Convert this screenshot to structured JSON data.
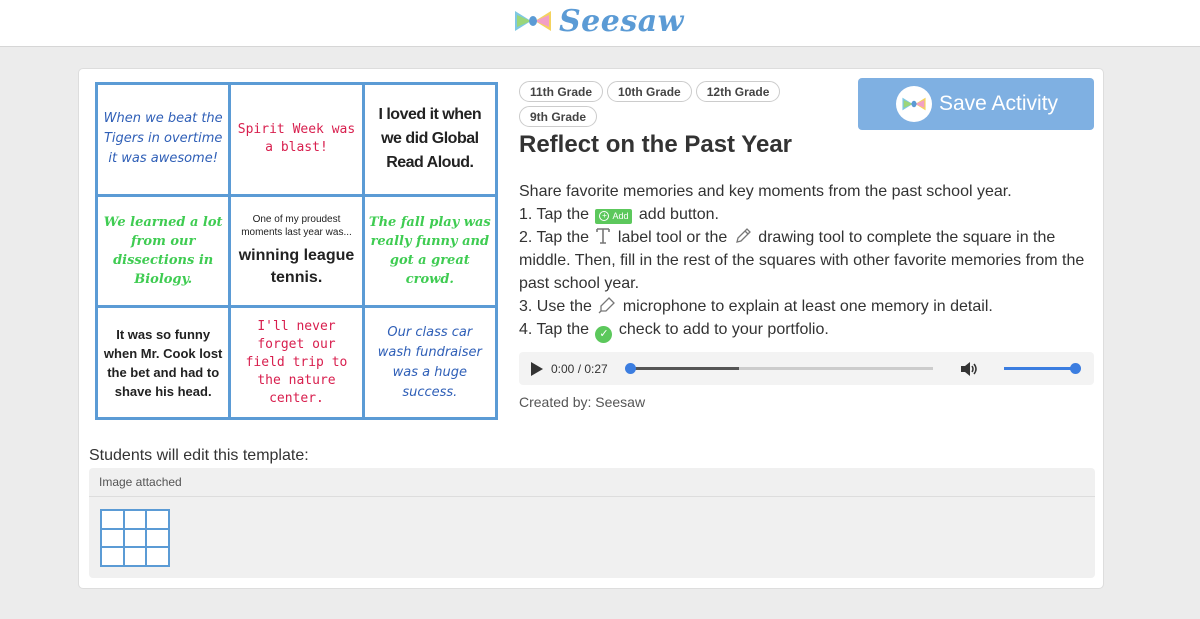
{
  "header": {
    "brand": "Seesaw",
    "logo_icon": "seesaw-bowtie-logo"
  },
  "template_image": {
    "cells": [
      "When we beat the Tigers in overtime it was awesome!",
      "Spirit Week was a blast!",
      "I loved it when we did Global Read Aloud.",
      "We learned a lot from our dissections in Biology.",
      "One of my proudest moments last year was...",
      "The fall play was really funny and got a great crowd.",
      "It was so funny when Mr. Cook lost the bet and had to shave his head.",
      "I'll never forget our field trip to the nature center.",
      "Our class car wash fundraiser was a huge success."
    ],
    "middle_answer": "winning league tennis."
  },
  "tags": [
    "11th Grade",
    "10th Grade",
    "12th Grade",
    "9th Grade"
  ],
  "save_button": {
    "label": "Save Activity"
  },
  "activity": {
    "title": "Reflect on the Past Year",
    "intro": "Share favorite memories and key moments from the past school year.",
    "step1_pre": "1. Tap the",
    "add_badge": "Add",
    "step1_post": "add button.",
    "step2_a": "2. Tap the",
    "step2_b": "label tool or the",
    "step2_c": "drawing tool to complete the square in the middle. Then, fill in the rest of the squares with other favorite memories from the past school year.",
    "step3_a": "3. Use the",
    "step3_b": "microphone to explain at least one memory in detail.",
    "step4_a": "4. Tap the",
    "step4_b": "check to add to your portfolio."
  },
  "audio": {
    "time": "0:00 / 0:27",
    "progress": 0,
    "buffered": 0.36,
    "volume": 1
  },
  "created_by": "Created by: Seesaw",
  "students_label": "Students will edit this template:",
  "attachment": {
    "header": "Image attached"
  },
  "colors": {
    "accent": "#5b9bd5",
    "save_button": "#7fb0e2",
    "green": "#5cc85c"
  }
}
